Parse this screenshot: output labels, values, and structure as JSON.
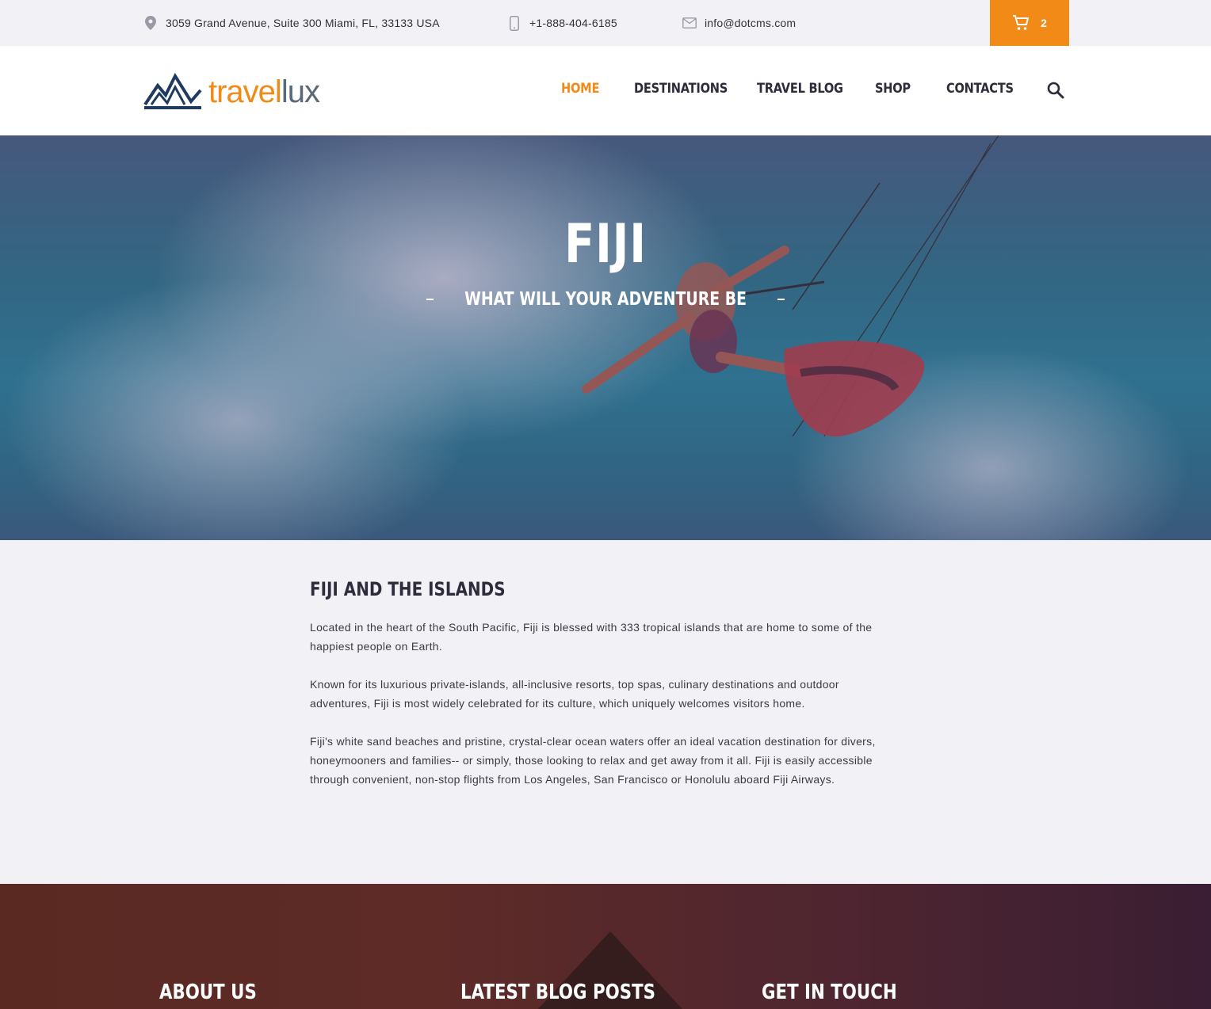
{
  "topbar": {
    "address": "3059 Grand Avenue, Suite 300 Miami, FL, 33133 USA",
    "phone": "+1-888-404-6185",
    "email": "info@dotcms.com",
    "cart_count": "2",
    "icons": [
      "map-pin-icon",
      "mobile-phone-icon",
      "envelope-icon",
      "shopping-cart-icon"
    ]
  },
  "header": {
    "logo_travel": "travel",
    "logo_lux": "lux",
    "nav": {
      "home": "HOME",
      "destinations": "DESTINATIONS",
      "travel_blog": "TRAVEL BLOG",
      "shop": "SHOP",
      "contacts": "CONTACTS"
    },
    "active_nav": "home"
  },
  "hero": {
    "title": "FIJI",
    "subtitle": "WHAT WILL YOUR ADVENTURE BE"
  },
  "content": {
    "heading": "FIJI AND THE ISLANDS",
    "paragraphs": [
      "Located in the heart of the South Pacific, Fiji is blessed with 333 tropical islands that are home to some of the happiest people on Earth.",
      "Known for its luxurious private-islands, all-inclusive resorts, top spas, culinary destinations and outdoor adventures, Fiji is most widely celebrated for its culture, which uniquely welcomes visitors home.",
      "Fiji's white sand beaches and pristine, crystal-clear ocean waters offer an ideal vacation destination for divers, honeymooners and families-- or simply, those looking to relax and get away from it all. Fiji is easily accessible through convenient, non-stop flights from Los Angeles, San Francisco or Honolulu aboard Fiji Airways."
    ]
  },
  "footer": {
    "about_heading": "ABOUT US",
    "blog_heading": "LATEST BLOG POSTS",
    "touch_heading": "GET IN TOUCH"
  },
  "colors": {
    "accent": "#f18a17",
    "nav_text": "#2e2c3a",
    "logo_gray": "#5a6878",
    "logo_navy": "#1e3a5f"
  }
}
